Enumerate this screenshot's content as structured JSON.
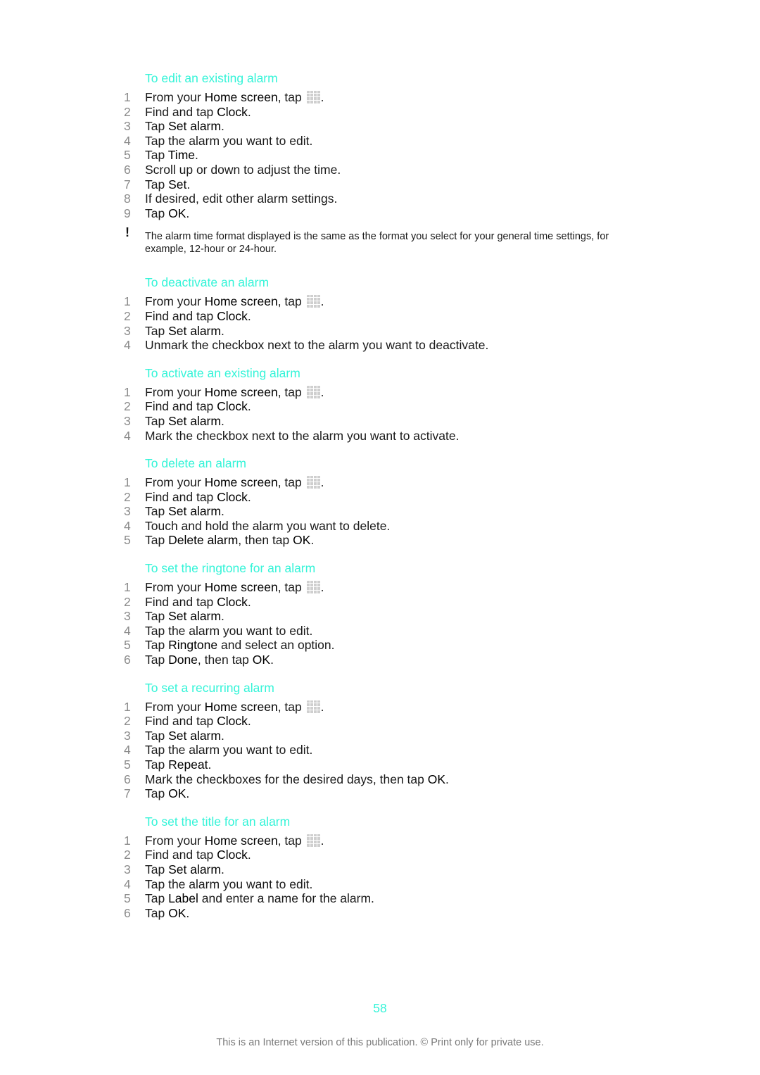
{
  "accent_color": "#34f4d8",
  "sections": [
    {
      "title": "To edit an existing alarm",
      "steps": [
        [
          "From your ",
          {
            "b": "Home screen"
          },
          ", tap ",
          {
            "icon": "apps-grid-icon"
          },
          "."
        ],
        [
          "Find and tap ",
          {
            "b": "Clock"
          },
          "."
        ],
        [
          "Tap ",
          {
            "b": "Set alarm"
          },
          "."
        ],
        [
          "Tap the alarm you want to edit."
        ],
        [
          "Tap ",
          {
            "b": "Time"
          },
          "."
        ],
        [
          "Scroll up or down to adjust the time."
        ],
        [
          "Tap ",
          {
            "b": "Set"
          },
          "."
        ],
        [
          "If desired, edit other alarm settings."
        ],
        [
          "Tap ",
          {
            "b": "OK"
          },
          "."
        ]
      ],
      "note": "The alarm time format displayed is the same as the format you select for your general time settings, for example, 12-hour or 24-hour."
    },
    {
      "title": "To deactivate an alarm",
      "steps": [
        [
          "From your ",
          {
            "b": "Home screen"
          },
          ", tap ",
          {
            "icon": "apps-grid-icon"
          },
          "."
        ],
        [
          "Find and tap ",
          {
            "b": "Clock"
          },
          "."
        ],
        [
          "Tap ",
          {
            "b": "Set alarm"
          },
          "."
        ],
        [
          "Unmark the checkbox next to the alarm you want to deactivate."
        ]
      ]
    },
    {
      "title": "To activate an existing alarm",
      "steps": [
        [
          "From your ",
          {
            "b": "Home screen"
          },
          ", tap ",
          {
            "icon": "apps-grid-icon"
          },
          "."
        ],
        [
          "Find and tap ",
          {
            "b": "Clock"
          },
          "."
        ],
        [
          "Tap ",
          {
            "b": "Set alarm"
          },
          "."
        ],
        [
          "Mark the checkbox next to the alarm you want to activate."
        ]
      ]
    },
    {
      "title": "To delete an alarm",
      "steps": [
        [
          "From your ",
          {
            "b": "Home screen"
          },
          ", tap ",
          {
            "icon": "apps-grid-icon"
          },
          "."
        ],
        [
          "Find and tap ",
          {
            "b": "Clock"
          },
          "."
        ],
        [
          "Tap ",
          {
            "b": "Set alarm"
          },
          "."
        ],
        [
          "Touch and hold the alarm you want to delete."
        ],
        [
          "Tap ",
          {
            "b": "Delete alarm"
          },
          ", then tap ",
          {
            "b": "OK"
          },
          "."
        ]
      ]
    },
    {
      "title": "To set the ringtone for an alarm",
      "steps": [
        [
          "From your ",
          {
            "b": "Home screen"
          },
          ", tap ",
          {
            "icon": "apps-grid-icon"
          },
          "."
        ],
        [
          "Find and tap ",
          {
            "b": "Clock"
          },
          "."
        ],
        [
          "Tap ",
          {
            "b": "Set alarm"
          },
          "."
        ],
        [
          "Tap the alarm you want to edit."
        ],
        [
          "Tap ",
          {
            "b": "Ringtone"
          },
          " and select an option."
        ],
        [
          "Tap ",
          {
            "b": "Done"
          },
          ", then tap ",
          {
            "b": "OK"
          },
          "."
        ]
      ]
    },
    {
      "title": "To set a recurring alarm",
      "steps": [
        [
          "From your ",
          {
            "b": "Home screen"
          },
          ", tap ",
          {
            "icon": "apps-grid-icon"
          },
          "."
        ],
        [
          "Find and tap ",
          {
            "b": "Clock"
          },
          "."
        ],
        [
          "Tap ",
          {
            "b": "Set alarm"
          },
          "."
        ],
        [
          "Tap the alarm you want to edit."
        ],
        [
          "Tap ",
          {
            "b": "Repeat"
          },
          "."
        ],
        [
          "Mark the checkboxes for the desired days, then tap ",
          {
            "b": "OK"
          },
          "."
        ],
        [
          "Tap ",
          {
            "b": "OK"
          },
          "."
        ]
      ]
    },
    {
      "title": "To set the title for an alarm",
      "steps": [
        [
          "From your ",
          {
            "b": "Home screen"
          },
          ", tap ",
          {
            "icon": "apps-grid-icon"
          },
          "."
        ],
        [
          "Find and tap ",
          {
            "b": "Clock"
          },
          "."
        ],
        [
          "Tap ",
          {
            "b": "Set alarm"
          },
          "."
        ],
        [
          "Tap the alarm you want to edit."
        ],
        [
          "Tap ",
          {
            "b": "Label"
          },
          " and enter a name for the alarm."
        ],
        [
          "Tap ",
          {
            "b": "OK"
          },
          "."
        ]
      ]
    }
  ],
  "note_icon": "exclamation-icon",
  "note_symbol": "!",
  "page_number": "58",
  "footer": "This is an Internet version of this publication. © Print only for private use."
}
